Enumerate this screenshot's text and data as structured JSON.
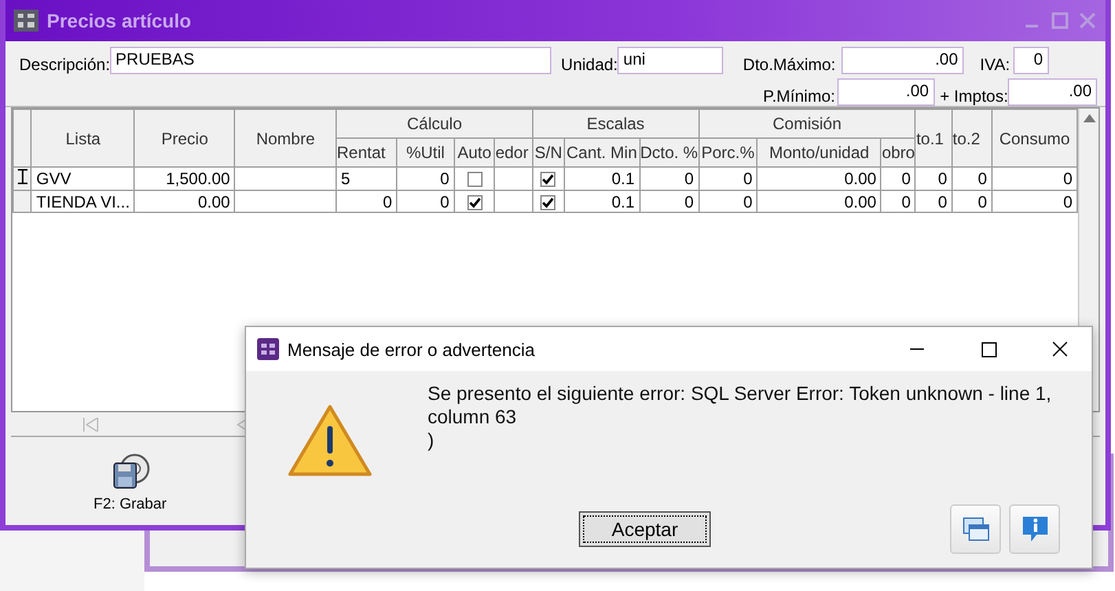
{
  "window": {
    "title": "Precios artículo"
  },
  "form": {
    "descripcion_label": "Descripción:",
    "descripcion": "PRUEBAS",
    "unidad_label": "Unidad:",
    "unidad": "uni",
    "dto_maximo_label": "Dto.Máximo:",
    "dto_maximo": ".00",
    "iva_label": "IVA:",
    "iva": "0",
    "p_minimo_label": "P.Mínimo:",
    "p_minimo": ".00",
    "imptos_label": "+ Imptos:",
    "imptos": ".00"
  },
  "grid": {
    "groups": [
      {
        "label": "Lista"
      },
      {
        "label": "Precio"
      },
      {
        "label": "Nombre"
      },
      {
        "label": "Cálculo",
        "columns": [
          "Rentat",
          "%Util",
          "Auto",
          "edor"
        ]
      },
      {
        "label": "Escalas",
        "columns": [
          "S/N",
          "Cant. Min",
          "Dcto. %"
        ]
      },
      {
        "label": "Comisión",
        "columns": [
          "Porc.%",
          "Monto/unidad",
          "obro"
        ]
      },
      {
        "label": "to.1"
      },
      {
        "label": "to.2"
      },
      {
        "label": "Consumo"
      }
    ],
    "rows": [
      {
        "current": true,
        "lista": "GVV",
        "precio": "1,500.00",
        "rentat": "5",
        "util": "0",
        "auto": false,
        "sn": true,
        "cant_min": "0.1",
        "dcto": "0",
        "porc": "0",
        "monto": "0.00",
        "cobro": "0",
        "dto1": "0",
        "dto2": "0",
        "consumo": "0"
      },
      {
        "current": false,
        "lista": "TIENDA VI...",
        "precio": "0.00",
        "rentat": "0",
        "util": "0",
        "auto": true,
        "sn": true,
        "cant_min": "0.1",
        "dcto": "0",
        "porc": "0",
        "monto": "0.00",
        "cobro": "0",
        "dto1": "0",
        "dto2": "0",
        "consumo": "0"
      }
    ]
  },
  "toolbar": {
    "save_label": "F2: Grabar"
  },
  "dialog": {
    "title": "Mensaje de error o advertencia",
    "message_lines": [
      "Se presento el siguiente error: SQL Server Error: Token unknown - line 1,",
      "column 63",
      ")"
    ],
    "ok": "Aceptar"
  }
}
